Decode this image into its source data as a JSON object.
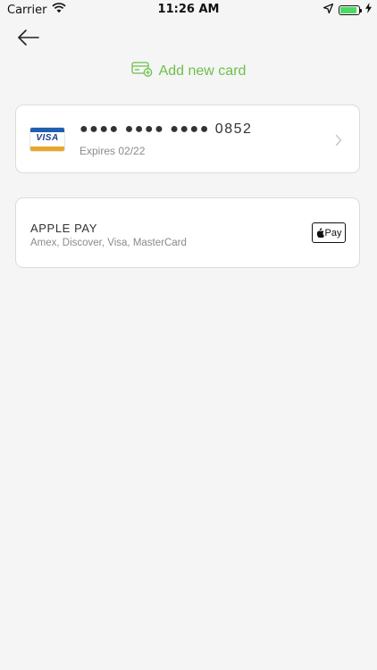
{
  "status_bar": {
    "carrier": "Carrier",
    "time": "11:26 AM",
    "battery_level": 0.9,
    "icons": [
      "wifi-icon",
      "location-arrow-icon",
      "battery-icon",
      "charging-bolt-icon"
    ]
  },
  "nav": {
    "back_icon": "arrow-left-icon"
  },
  "add_card": {
    "label": "Add new card",
    "icon": "card-plus-icon",
    "color": "#6cc04a"
  },
  "saved_card": {
    "brand": "VISA",
    "number_masked": "●●●● ●●●● ●●●● 0852",
    "expiry": "Expires 02/22",
    "chevron_icon": "chevron-right-icon"
  },
  "apple_pay": {
    "title": "APPLE PAY",
    "subtitle": "Amex, Discover, Visa, MasterCard",
    "badge_text": "Pay",
    "badge_icon": "apple-logo-icon"
  },
  "colors": {
    "background": "#f5f5f5",
    "accent_green": "#6cc04a",
    "visa_blue": "#1f5fae",
    "visa_gold": "#e8a72a"
  }
}
